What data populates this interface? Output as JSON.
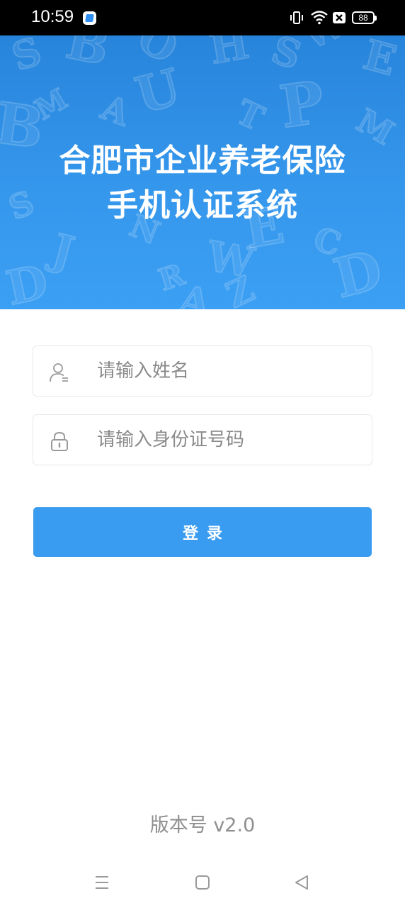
{
  "status_bar": {
    "time": "10:59",
    "battery": "88",
    "icons": [
      "app-notification-icon",
      "vibrate-icon",
      "wifi-icon",
      "no-sim-icon",
      "battery-icon"
    ]
  },
  "header": {
    "title_line1": "合肥市企业养老保险",
    "title_line2": "手机认证系统",
    "background_color": "#3597ec"
  },
  "form": {
    "name_field": {
      "placeholder": "请输入姓名",
      "value": "",
      "icon": "user-icon"
    },
    "id_field": {
      "placeholder": "请输入身份证号码",
      "value": "",
      "icon": "lock-icon"
    },
    "login_label": "登录",
    "button_color": "#3a9cf1"
  },
  "footer": {
    "version": "版本号  v2.0"
  },
  "nav_bar": {
    "icons": [
      "menu-icon",
      "home-icon",
      "back-icon"
    ]
  }
}
